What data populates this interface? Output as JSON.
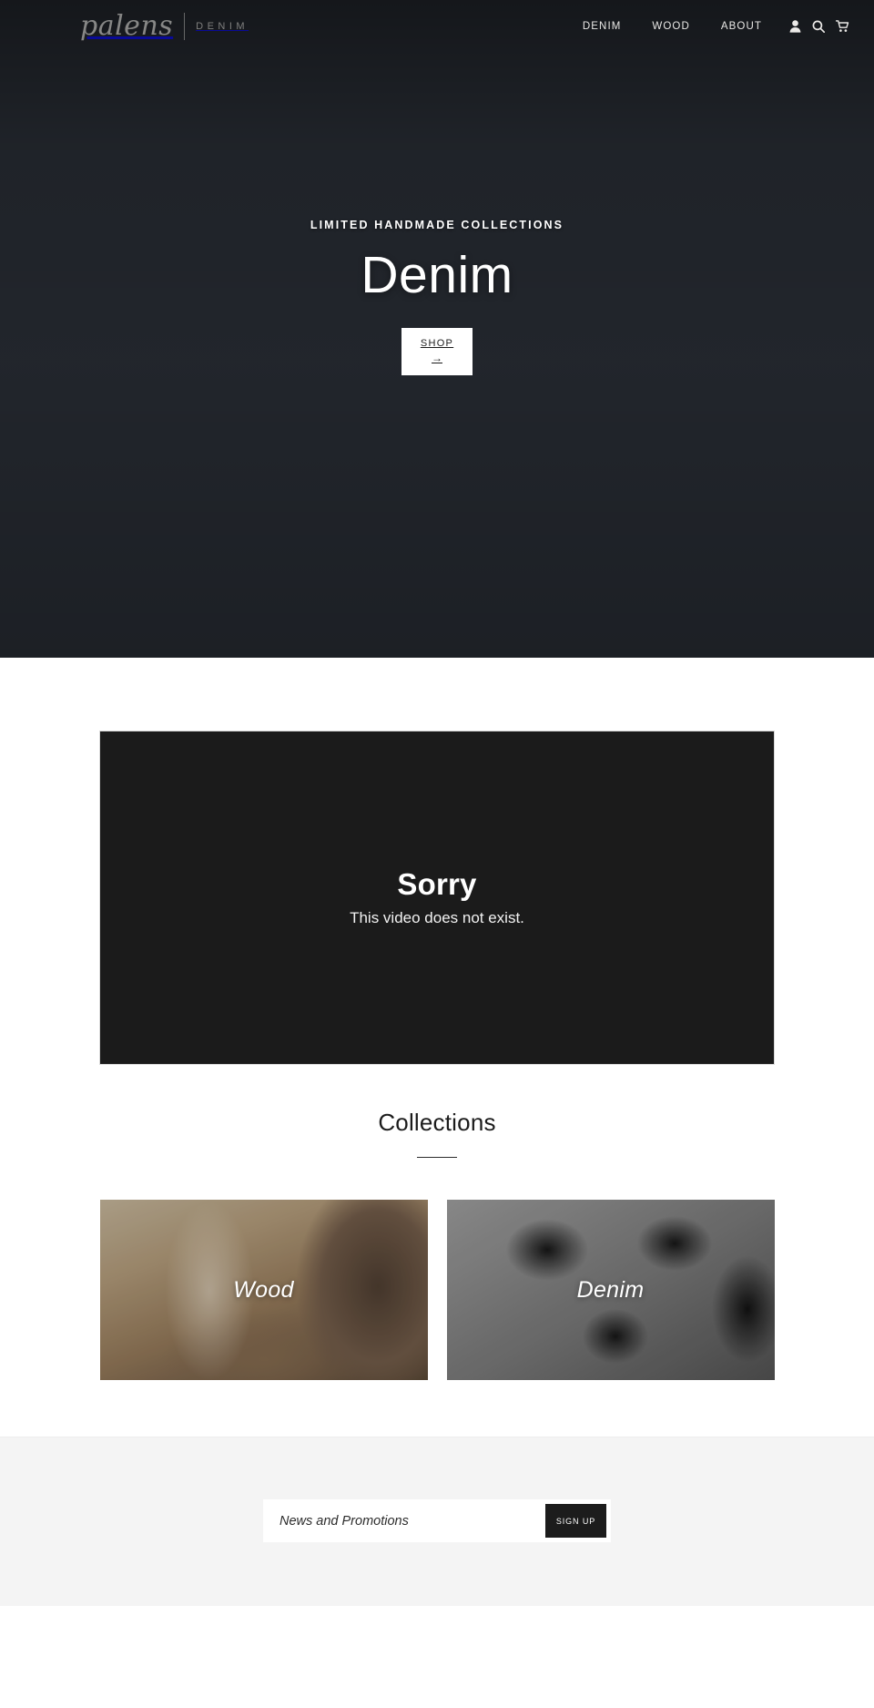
{
  "header": {
    "brand_script": "palens",
    "brand_divider": "|",
    "brand_sub": "DENIM",
    "nav": [
      {
        "label": "DENIM"
      },
      {
        "label": "WOOD"
      },
      {
        "label": "ABOUT"
      }
    ],
    "icons": [
      {
        "name": "account-icon",
        "title": "Account"
      },
      {
        "name": "search-icon",
        "title": "Search"
      },
      {
        "name": "cart-icon",
        "title": "Cart"
      }
    ]
  },
  "hero": {
    "kicker": "LIMITED HANDMADE COLLECTIONS",
    "title": "Denim",
    "button_label": "SHOP",
    "button_arrow": "→"
  },
  "video": {
    "error_title": "Sorry",
    "error_message": "This video does not exist."
  },
  "collections": {
    "heading": "Collections",
    "cards": [
      {
        "label": "Wood"
      },
      {
        "label": "Denim"
      }
    ]
  },
  "newsletter": {
    "placeholder": "News and Promotions",
    "value": "",
    "button_label": "SIGN UP"
  },
  "colors": {
    "accent_dark": "#1c1c1c",
    "video_bg": "#1b1b1b",
    "newsletter_bg": "#f4f4f4",
    "text_light": "#ffffff"
  }
}
